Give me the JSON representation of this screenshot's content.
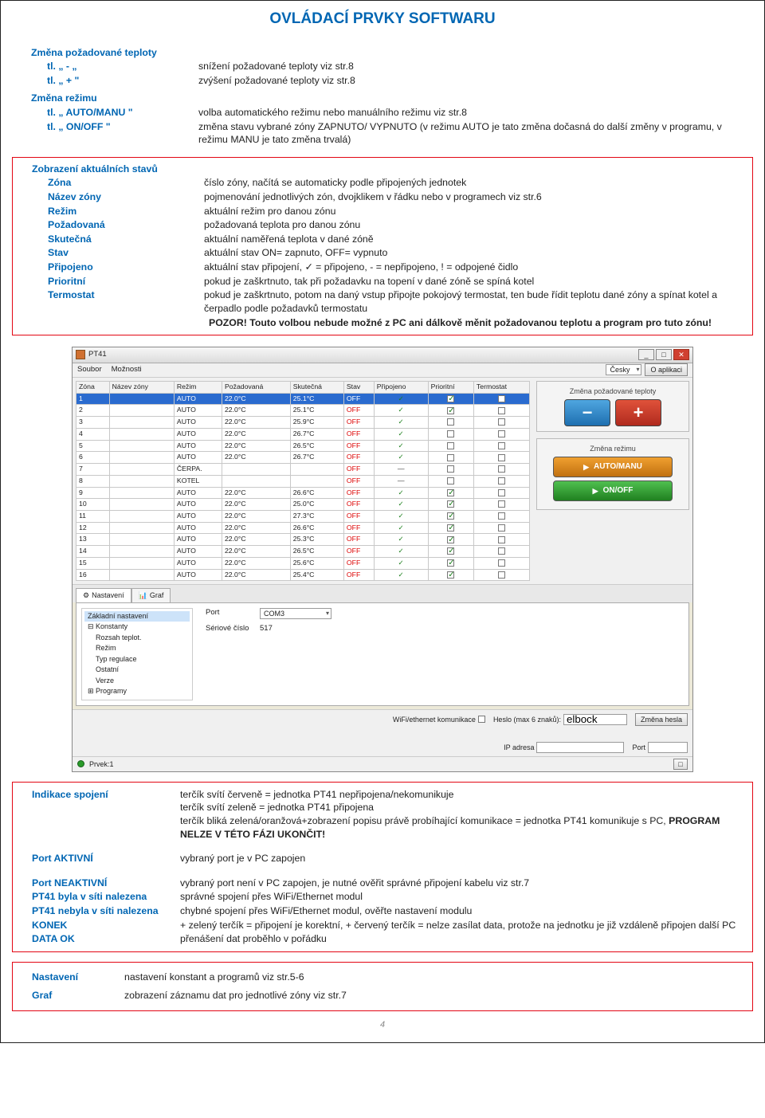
{
  "title": "OVLÁDACÍ PRVKY SOFTWARU",
  "section1": {
    "h1": "Změna požadované teploty",
    "r1": {
      "lab": "tl. „ - „",
      "val": "snížení požadované teploty viz str.8"
    },
    "r2": {
      "lab": "tl. „ + \"",
      "val": "zvýšení požadované teploty viz str.8"
    },
    "h2": "Změna režimu",
    "r3": {
      "lab": "tl. „ AUTO/MANU \"",
      "val": "volba automatického režimu nebo manuálního režimu viz str.8"
    },
    "r4": {
      "lab": "tl. „ ON/OFF \"",
      "val": "změna stavu vybrané zóny ZAPNUTO/ VYPNUTO (v režimu AUTO je tato změna dočasná do další změny v programu, v režimu MANU je tato změna trvalá)"
    }
  },
  "section2": {
    "h": "Zobrazení aktuálních stavů",
    "rows": [
      {
        "lab": "Zóna",
        "val": "číslo zóny, načítá se automaticky podle připojených jednotek"
      },
      {
        "lab": "Název zóny",
        "val": "pojmenování jednotlivých zón, dvojklikem v řádku nebo v programech viz str.6"
      },
      {
        "lab": "Režim",
        "val": "aktuální režim pro danou zónu"
      },
      {
        "lab": "Požadovaná",
        "val": "požadovaná teplota pro danou zónu"
      },
      {
        "lab": "Skutečná",
        "val": "aktuální naměřená teplota v dané zóně"
      },
      {
        "lab": "Stav",
        "val": "aktuální stav ON= zapnuto, OFF= vypnuto"
      },
      {
        "lab": "Připojeno",
        "val": "aktuální stav připojení, ✓ = připojeno, - = nepřipojeno, ! = odpojené čidlo"
      },
      {
        "lab": "Prioritní",
        "val": "pokud je zaškrtnuto, tak při požadavku na topení v dané zóně se spíná kotel"
      },
      {
        "lab": "Termostat",
        "val": "pokud je zaškrtnuto, potom na daný vstup připojte pokojový termostat, ten bude řídit teplotu dané zóny a spínat kotel a čerpadlo podle požadavků termostatu"
      }
    ],
    "warn1a": "POZOR",
    "warn1b": "! Touto volbou nebude možné z PC ani dálkově měnit požadovanou teplotu a program pro tuto zónu!"
  },
  "app": {
    "wintitle": "PT41",
    "menu_soubor": "Soubor",
    "menu_moznosti": "Možnosti",
    "menu_lang": "Česky",
    "menu_about": "O aplikaci",
    "cols": {
      "zona": "Zóna",
      "nazev": "Název zóny",
      "rezim": "Režim",
      "pozad": "Požadovaná",
      "skut": "Skutečná",
      "stav": "Stav",
      "prip": "Připojeno",
      "prior": "Prioritní",
      "term": "Termostat"
    },
    "rows": [
      {
        "z": "1",
        "n": "",
        "r": "AUTO",
        "p": "22.0°C",
        "s": "25.1°C",
        "st": "OFF",
        "c": "✓",
        "pr": true,
        "t": false,
        "sel": true
      },
      {
        "z": "2",
        "n": "",
        "r": "AUTO",
        "p": "22.0°C",
        "s": "25.1°C",
        "st": "OFF",
        "c": "✓",
        "pr": true,
        "t": false
      },
      {
        "z": "3",
        "n": "",
        "r": "AUTO",
        "p": "22.0°C",
        "s": "25.9°C",
        "st": "OFF",
        "c": "✓",
        "pr": false,
        "t": false
      },
      {
        "z": "4",
        "n": "",
        "r": "AUTO",
        "p": "22.0°C",
        "s": "26.7°C",
        "st": "OFF",
        "c": "✓",
        "pr": false,
        "t": false
      },
      {
        "z": "5",
        "n": "",
        "r": "AUTO",
        "p": "22.0°C",
        "s": "26.5°C",
        "st": "OFF",
        "c": "✓",
        "pr": false,
        "t": false
      },
      {
        "z": "6",
        "n": "",
        "r": "AUTO",
        "p": "22.0°C",
        "s": "26.7°C",
        "st": "OFF",
        "c": "✓",
        "pr": false,
        "t": false
      },
      {
        "z": "7",
        "n": "",
        "r": "ČERPA.",
        "p": "",
        "s": "",
        "st": "OFF",
        "c": "—",
        "pr": false,
        "t": false
      },
      {
        "z": "8",
        "n": "",
        "r": "KOTEL",
        "p": "",
        "s": "",
        "st": "OFF",
        "c": "—",
        "pr": false,
        "t": false
      },
      {
        "z": "9",
        "n": "",
        "r": "AUTO",
        "p": "22.0°C",
        "s": "26.6°C",
        "st": "OFF",
        "c": "✓",
        "pr": true,
        "t": false
      },
      {
        "z": "10",
        "n": "",
        "r": "AUTO",
        "p": "22.0°C",
        "s": "25.0°C",
        "st": "OFF",
        "c": "✓",
        "pr": true,
        "t": false
      },
      {
        "z": "11",
        "n": "",
        "r": "AUTO",
        "p": "22.0°C",
        "s": "27.3°C",
        "st": "OFF",
        "c": "✓",
        "pr": true,
        "t": false
      },
      {
        "z": "12",
        "n": "",
        "r": "AUTO",
        "p": "22.0°C",
        "s": "26.6°C",
        "st": "OFF",
        "c": "✓",
        "pr": true,
        "t": false
      },
      {
        "z": "13",
        "n": "",
        "r": "AUTO",
        "p": "22.0°C",
        "s": "25.3°C",
        "st": "OFF",
        "c": "✓",
        "pr": true,
        "t": false
      },
      {
        "z": "14",
        "n": "",
        "r": "AUTO",
        "p": "22.0°C",
        "s": "26.5°C",
        "st": "OFF",
        "c": "✓",
        "pr": true,
        "t": false
      },
      {
        "z": "15",
        "n": "",
        "r": "AUTO",
        "p": "22.0°C",
        "s": "25.6°C",
        "st": "OFF",
        "c": "✓",
        "pr": true,
        "t": false
      },
      {
        "z": "16",
        "n": "",
        "r": "AUTO",
        "p": "22.0°C",
        "s": "25.4°C",
        "st": "OFF",
        "c": "✓",
        "pr": true,
        "t": false
      }
    ],
    "side": {
      "temp_ttl": "Změna požadované teploty",
      "mode_ttl": "Změna režimu",
      "auto_btn": "AUTO/MANU",
      "onoff_btn": "ON/OFF"
    },
    "tabs": {
      "nast": "Nastavení",
      "graf": "Graf"
    },
    "tree": {
      "n0": "Základní nastavení",
      "n1": "Konstanty",
      "s1": "Rozsah teplot.",
      "s2": "Režim",
      "s3": "Typ regulace",
      "s4": "Ostatní",
      "s5": "Verze",
      "n2": "Programy"
    },
    "cfg": {
      "port_lab": "Port",
      "port_val": "COM3",
      "serial_lab": "Sériové číslo",
      "serial_val": "517"
    },
    "net": {
      "wifi_lab": "WiFi/ethernet komunikace",
      "pass_lab": "Heslo (max 6 znaků):",
      "pass_val": "elbock",
      "change_btn": "Změna hesla",
      "ip_lab": "IP adresa",
      "port_lab": "Port"
    },
    "status": "Prvek:1"
  },
  "section3": {
    "r1": {
      "lab": "Indikace spojení",
      "val": "terčík svítí červeně = jednotka PT41 nepřipojena/nekomunikuje\nterčík svítí zeleně = jednotka PT41 připojena\nterčík bliká zelená/oranžová+zobrazení popisu právě probíhající komunikace = jednotka PT41 komunikuje s PC, ",
      "bold": "PROGRAM NELZE V TÉTO FÁZI UKONČIT!"
    },
    "r2": {
      "lab": "Port AKTIVNÍ",
      "val": "vybraný port je v PC zapojen"
    },
    "r3": {
      "lab": "Port NEAKTIVNÍ",
      "val": "vybraný port není v PC zapojen, je nutné ověřit správné připojení kabelu viz str.7"
    },
    "r4": {
      "lab": "PT41 byla v síti nalezena",
      "val": "správné spojení přes WiFi/Ethernet modul"
    },
    "r5": {
      "lab": "PT41 nebyla v síti nalezena",
      "val": "chybné spojení přes WiFi/Ethernet modul, ověřte nastavení modulu"
    },
    "r6": {
      "lab": "KONEK",
      "val": "+ zelený terčík = připojení je korektní, + červený terčík = nelze zasílat data, protože na jednotku je již vzdáleně připojen další PC"
    },
    "r7": {
      "lab": "DATA OK",
      "val": "přenášení dat proběhlo v pořádku"
    }
  },
  "section4": {
    "r1": {
      "lab": "Nastavení",
      "val": "nastavení konstant a programů viz str.5-6"
    },
    "r2": {
      "lab": "Graf",
      "val": "zobrazení záznamu dat pro jednotlivé zóny viz str.7"
    }
  },
  "pgnum": "4"
}
